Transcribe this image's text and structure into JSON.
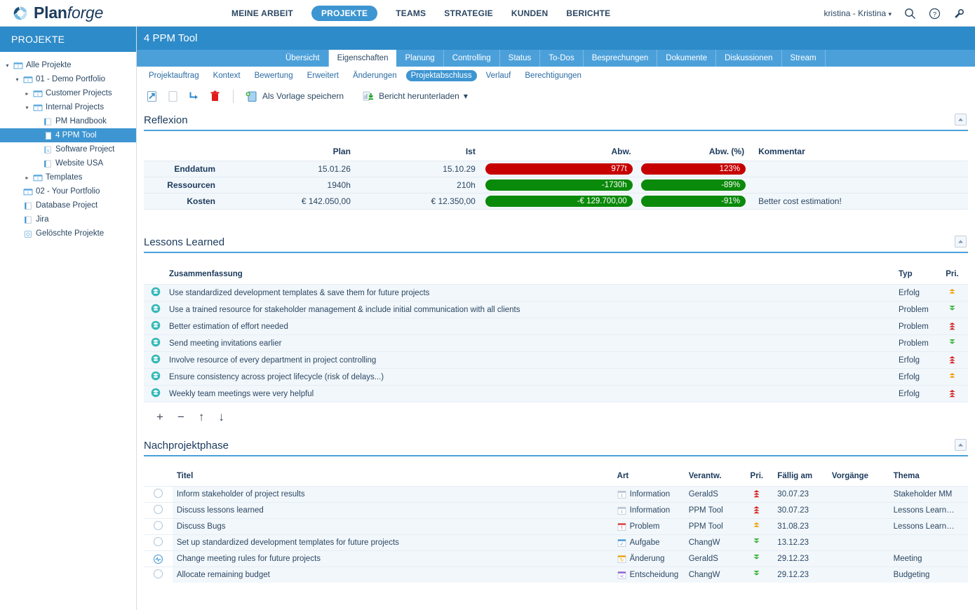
{
  "brand": {
    "name_bold": "Plan",
    "name_italic": "forge"
  },
  "topnav": {
    "items": [
      {
        "label": "MEINE ARBEIT",
        "active": false
      },
      {
        "label": "PROJEKTE",
        "active": true
      },
      {
        "label": "TEAMS",
        "active": false
      },
      {
        "label": "STRATEGIE",
        "active": false
      },
      {
        "label": "KUNDEN",
        "active": false
      },
      {
        "label": "BERICHTE",
        "active": false
      }
    ],
    "user": "kristina - Kristina",
    "caret": "▾"
  },
  "sidebar": {
    "header": "PROJEKTE",
    "tree": [
      {
        "label": "Alle Projekte",
        "indent": 0,
        "twist": "▾",
        "icon": "folder",
        "selected": false
      },
      {
        "label": "01 - Demo Portfolio",
        "indent": 1,
        "twist": "▾",
        "icon": "folder",
        "selected": false
      },
      {
        "label": "Customer Projects",
        "indent": 2,
        "twist": "▸",
        "icon": "folder",
        "selected": false
      },
      {
        "label": "Internal Projects",
        "indent": 2,
        "twist": "▾",
        "icon": "folder",
        "selected": false
      },
      {
        "label": "PM Handbook",
        "indent": 3,
        "twist": "",
        "icon": "project",
        "selected": false
      },
      {
        "label": "4 PPM Tool",
        "indent": 3,
        "twist": "",
        "icon": "project",
        "selected": true
      },
      {
        "label": "Software Project",
        "indent": 3,
        "twist": "",
        "icon": "project-alt",
        "selected": false
      },
      {
        "label": "Website USA",
        "indent": 3,
        "twist": "",
        "icon": "project",
        "selected": false
      },
      {
        "label": "Templates",
        "indent": 2,
        "twist": "▸",
        "icon": "folder",
        "selected": false
      },
      {
        "label": "02 - Your Portfolio",
        "indent": 1,
        "twist": "",
        "icon": "folder",
        "selected": false
      },
      {
        "label": "Database Project",
        "indent": 1,
        "twist": "",
        "icon": "project",
        "selected": false
      },
      {
        "label": "Jira",
        "indent": 1,
        "twist": "",
        "icon": "project",
        "selected": false
      },
      {
        "label": "Gelöschte Projekte",
        "indent": 1,
        "twist": "",
        "icon": "trash",
        "selected": false
      }
    ]
  },
  "page": {
    "title": "4 PPM Tool",
    "tabs": [
      {
        "label": "Übersicht",
        "active": false
      },
      {
        "label": "Eigenschaften",
        "active": true
      },
      {
        "label": "Planung",
        "active": false
      },
      {
        "label": "Controlling",
        "active": false
      },
      {
        "label": "Status",
        "active": false
      },
      {
        "label": "To-Dos",
        "active": false
      },
      {
        "label": "Besprechungen",
        "active": false
      },
      {
        "label": "Dokumente",
        "active": false
      },
      {
        "label": "Diskussionen",
        "active": false
      },
      {
        "label": "Stream",
        "active": false
      }
    ],
    "subtabs": [
      {
        "label": "Projektauftrag",
        "active": false
      },
      {
        "label": "Kontext",
        "active": false
      },
      {
        "label": "Bewertung",
        "active": false
      },
      {
        "label": "Erweitert",
        "active": false
      },
      {
        "label": "Änderungen",
        "active": false
      },
      {
        "label": "Projektabschluss",
        "active": true
      },
      {
        "label": "Verlauf",
        "active": false
      },
      {
        "label": "Berechtigungen",
        "active": false
      }
    ]
  },
  "toolbar": {
    "save_template_label": "Als Vorlage speichern",
    "download_report_label": "Bericht herunterladen",
    "download_caret": "▾"
  },
  "reflexion": {
    "title": "Reflexion",
    "columns": [
      "",
      "Plan",
      "Ist",
      "Abw.",
      "Abw. (%)",
      "Kommentar"
    ],
    "rows": [
      {
        "label": "Enddatum",
        "plan": "15.01.26",
        "ist": "15.10.29",
        "abw": "977t",
        "abw_color": "red",
        "abw_pct": "123%",
        "abw_pct_color": "red",
        "kommentar": ""
      },
      {
        "label": "Ressourcen",
        "plan": "1940h",
        "ist": "210h",
        "abw": "-1730h",
        "abw_color": "green",
        "abw_pct": "-89%",
        "abw_pct_color": "green",
        "kommentar": ""
      },
      {
        "label": "Kosten",
        "plan": "€ 142.050,00",
        "ist": "€ 12.350,00",
        "abw": "-€ 129.700,00",
        "abw_color": "green",
        "abw_pct": "-91%",
        "abw_pct_color": "green",
        "kommentar": "Better cost estimation!"
      }
    ]
  },
  "lessons_learned": {
    "title": "Lessons Learned",
    "columns": {
      "summary": "Zusammenfassung",
      "type": "Typ",
      "priority": "Pri."
    },
    "rows": [
      {
        "summary": "Use standardized development templates & save them for future projects",
        "typ": "Erfolg",
        "pri": "up2-orange"
      },
      {
        "summary": "Use a trained resource for stakeholder management & include initial communication with all clients",
        "typ": "Problem",
        "pri": "down2-green"
      },
      {
        "summary": "Better estimation of effort needed",
        "typ": "Problem",
        "pri": "up3-red"
      },
      {
        "summary": "Send meeting invitations earlier",
        "typ": "Problem",
        "pri": "down2-green"
      },
      {
        "summary": "Involve resource of every department in project controlling",
        "typ": "Erfolg",
        "pri": "up3-red"
      },
      {
        "summary": "Ensure consistency across project lifecycle (risk of delays...)",
        "typ": "Erfolg",
        "pri": "up2-orange"
      },
      {
        "summary": "Weekly team meetings were very helpful",
        "typ": "Erfolg",
        "pri": "up3-red"
      }
    ],
    "row_buttons": [
      {
        "label": "+",
        "name": "add-row-button"
      },
      {
        "label": "−",
        "name": "remove-row-button"
      },
      {
        "label": "↑",
        "name": "move-up-button"
      },
      {
        "label": "↓",
        "name": "move-down-button"
      }
    ]
  },
  "nachprojektphase": {
    "title": "Nachprojektphase",
    "columns": {
      "titel": "Titel",
      "art": "Art",
      "verantw": "Verantw.",
      "pri": "Pri.",
      "faellig": "Fällig am",
      "vorgaenge": "Vorgänge",
      "thema": "Thema"
    },
    "rows": [
      {
        "status": "open",
        "titel": "Inform stakeholder of project results",
        "art": "Information",
        "art_icon": "info-grey",
        "verantw": "GeraldS",
        "pri": "up3-red",
        "faellig": "30.07.23",
        "vorgaenge": "",
        "thema": "Stakeholder MM"
      },
      {
        "status": "open",
        "titel": "Discuss lessons learned",
        "art": "Information",
        "art_icon": "info-grey",
        "verantw": "PPM Tool",
        "pri": "up3-red",
        "faellig": "30.07.23",
        "vorgaenge": "",
        "thema": "Lessons Learn…"
      },
      {
        "status": "open",
        "titel": "Discuss Bugs",
        "art": "Problem",
        "art_icon": "problem-red",
        "verantw": "PPM Tool",
        "pri": "up2-orange",
        "faellig": "31.08.23",
        "vorgaenge": "",
        "thema": "Lessons Learn…"
      },
      {
        "status": "open",
        "titel": "Set up standardized development templates for future projects",
        "art": "Aufgabe",
        "art_icon": "task-blue",
        "verantw": "ChangW",
        "pri": "down2-green",
        "faellig": "13.12.23",
        "vorgaenge": "",
        "thema": ""
      },
      {
        "status": "active",
        "titel": "Change meeting rules for future projects",
        "art": "Änderung",
        "art_icon": "change-orange",
        "verantw": "GeraldS",
        "pri": "down2-green",
        "faellig": "29.12.23",
        "vorgaenge": "",
        "thema": "Meeting"
      },
      {
        "status": "open",
        "titel": "Allocate remaining budget",
        "art": "Entscheidung",
        "art_icon": "decision-purple",
        "verantw": "ChangW",
        "pri": "down2-green",
        "faellig": "29.12.23",
        "vorgaenge": "",
        "thema": "Budgeting"
      }
    ]
  },
  "colors": {
    "brand_blue": "#2e8bc9",
    "accent_blue": "#3d95d1",
    "tab_blue": "#4ba0da",
    "negative_red": "#c60000",
    "positive_green": "#0a8a0a",
    "row_bg": "#f2f7fb",
    "text_navy": "#1b3a5c"
  }
}
